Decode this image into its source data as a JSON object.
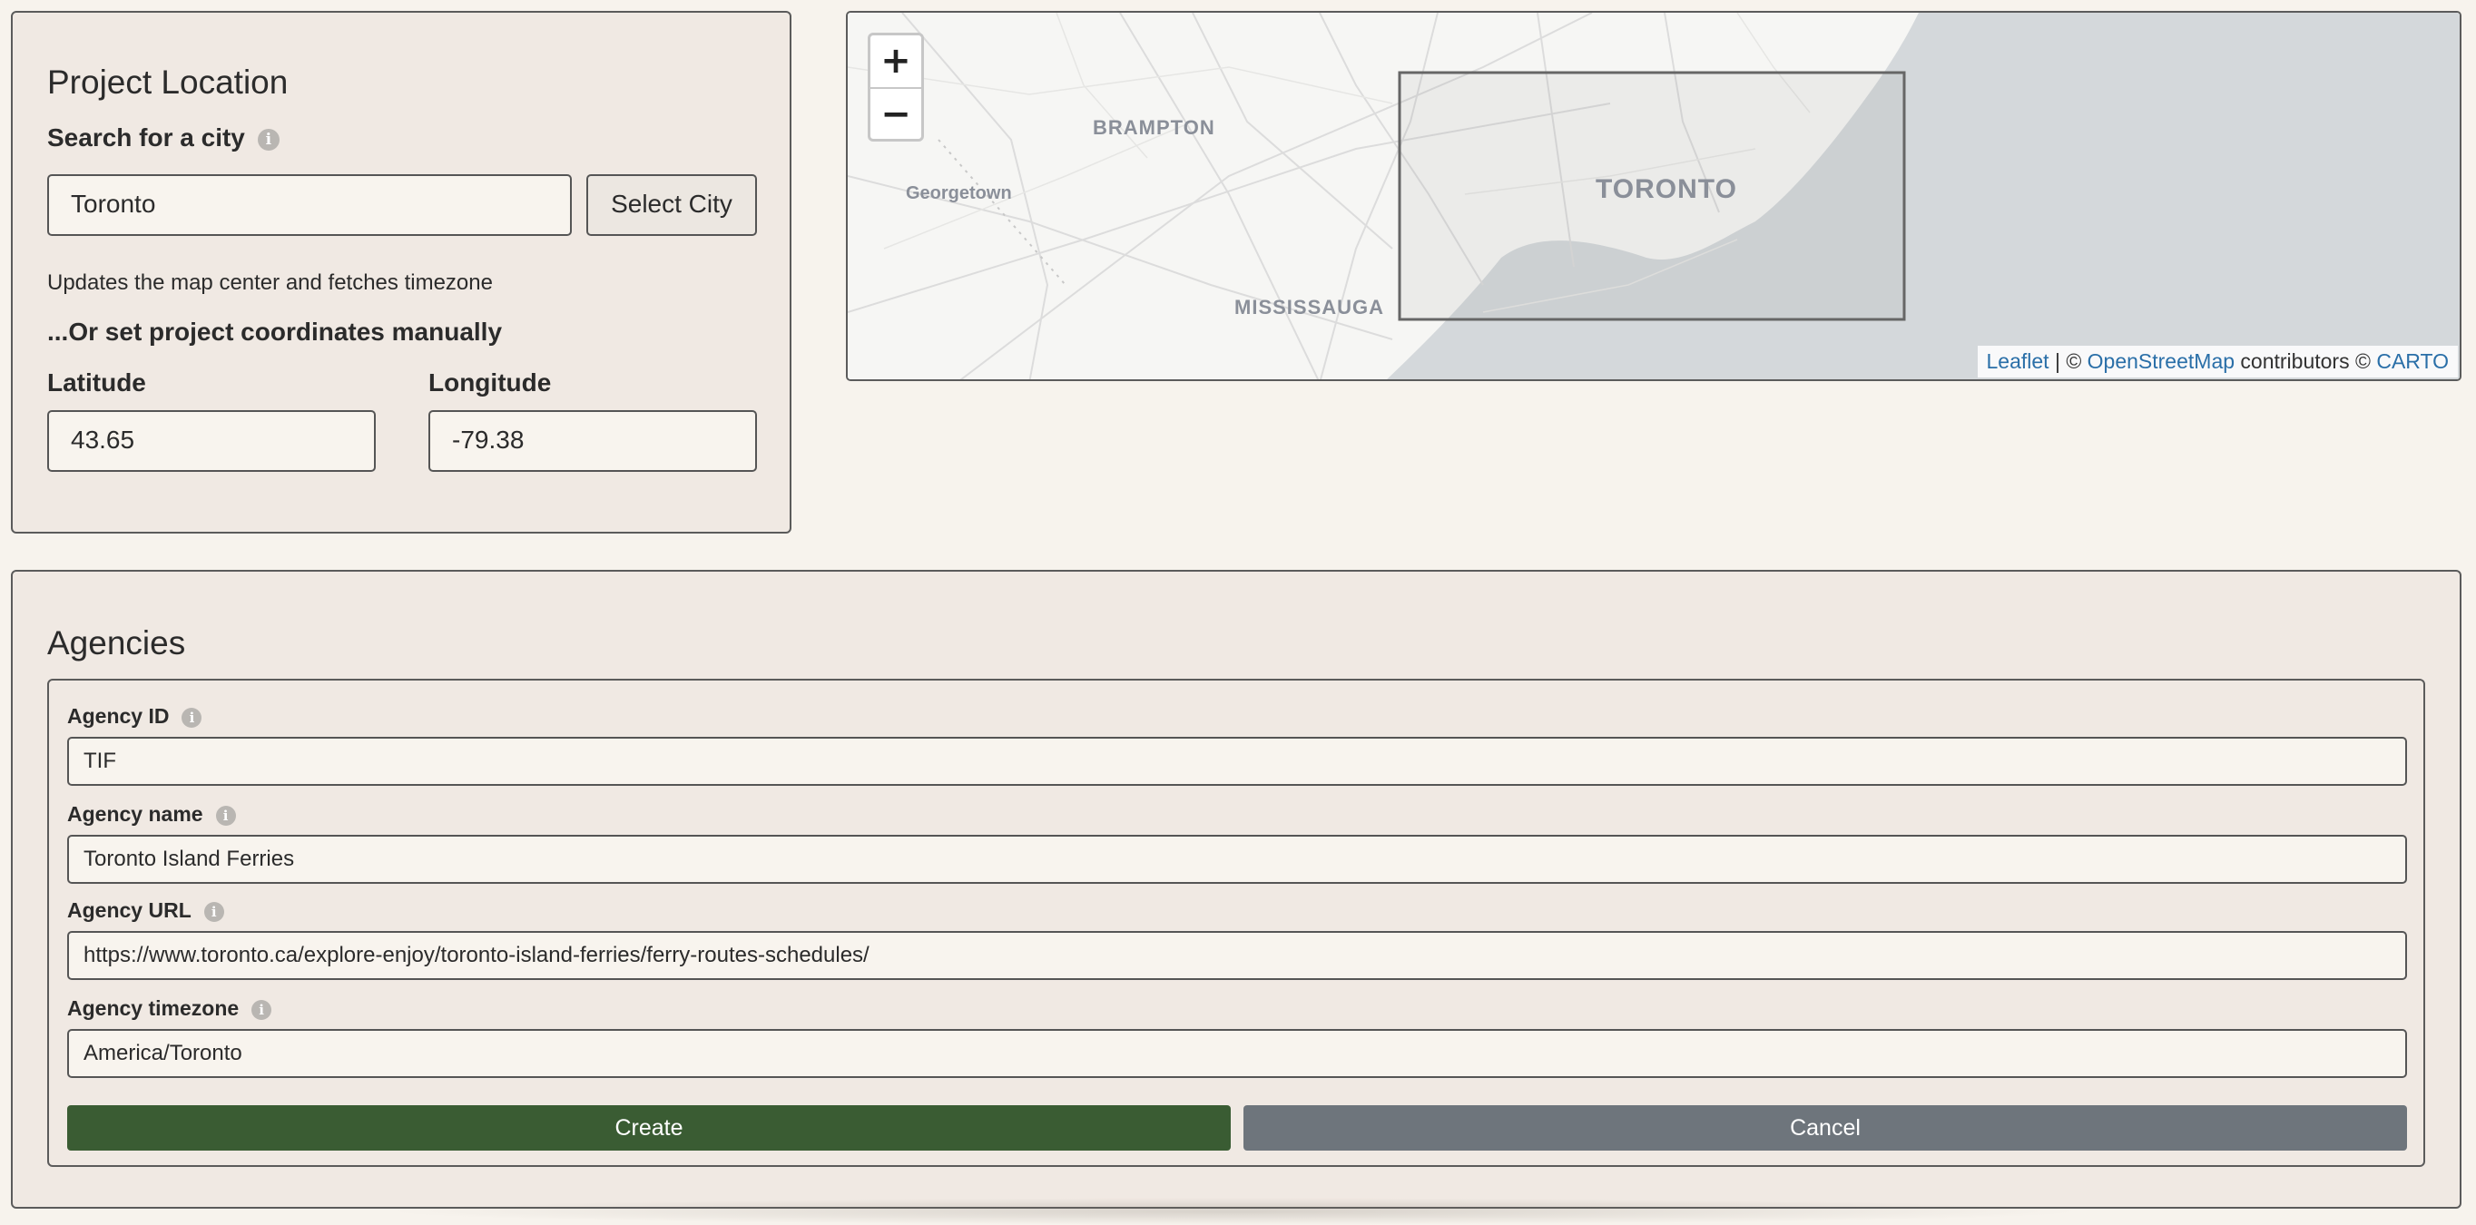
{
  "location": {
    "title": "Project Location",
    "search_label": "Search for a city",
    "city_value": "Toronto",
    "select_city_label": "Select City",
    "hint": "Updates the map center and fetches timezone",
    "manual_heading": "...Or set project coordinates manually",
    "latitude_label": "Latitude",
    "latitude_value": "43.65",
    "longitude_label": "Longitude",
    "longitude_value": "-79.38"
  },
  "map": {
    "zoom_in": "+",
    "zoom_out": "−",
    "labels": {
      "brampton": "BRAMPTON",
      "georgetown": "Georgetown",
      "toronto": "TORONTO",
      "mississauga": "MISSISSAUGA"
    },
    "attribution": {
      "leaflet": "Leaflet",
      "sep": " | © ",
      "osm": "OpenStreetMap",
      "contributors": " contributors © ",
      "carto": "CARTO"
    },
    "colors": {
      "water": "#d4d8db",
      "land": "#f6f6f4",
      "box": "#666666"
    }
  },
  "agencies": {
    "title": "Agencies",
    "fields": [
      {
        "label": "Agency ID",
        "value": "TIF"
      },
      {
        "label": "Agency name",
        "value": "Toronto Island Ferries"
      },
      {
        "label": "Agency URL",
        "value": "https://www.toronto.ca/explore-enjoy/toronto-island-ferries/ferry-routes-schedules/"
      },
      {
        "label": "Agency timezone",
        "value": "America/Toronto"
      }
    ],
    "create_label": "Create",
    "cancel_label": "Cancel",
    "colors": {
      "create": "#3a5c33",
      "cancel": "#6e757c"
    }
  },
  "info_glyph": "i"
}
